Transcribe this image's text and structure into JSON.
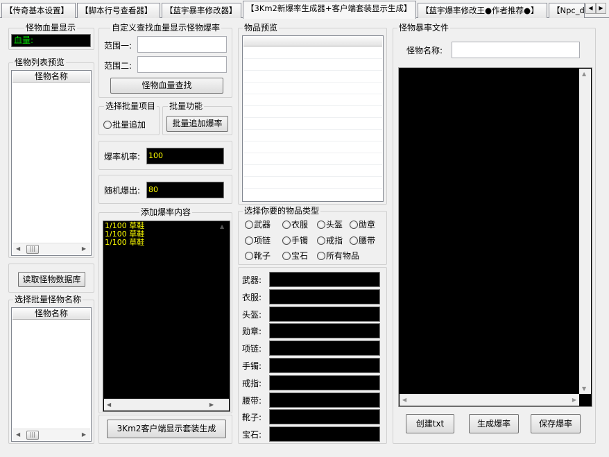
{
  "tabs": [
    {
      "label": "【传奇基本设置】"
    },
    {
      "label": "【脚本行号查看器】"
    },
    {
      "label": "【蓝宇暴率修改器】"
    },
    {
      "label": "【3Km2新爆率生成器+客户端套装显示生成】"
    },
    {
      "label": "【蓝宇爆率修改王●作者推荐●】"
    },
    {
      "label": "【Npc_d"
    }
  ],
  "tab_scroll": {
    "left": "◀",
    "right": "▶"
  },
  "monster_hp": {
    "title": "怪物血量显示",
    "label": "血量:"
  },
  "monster_list": {
    "title": "怪物列表预览",
    "column": "怪物名称"
  },
  "read_db_button": "读取怪物数据库",
  "batch_monster": {
    "title": "选择批量怪物名称",
    "column": "怪物名称"
  },
  "custom_find": {
    "title": "自定义查找血量显示怪物爆率",
    "range1": "范围一:",
    "range2": "范围二:",
    "button": "怪物血量查找"
  },
  "batch_item": {
    "title": "选择批量项目",
    "option": "批量追加"
  },
  "batch_func": {
    "title": "批量功能",
    "button": "批量追加爆率"
  },
  "drop_rate": {
    "label": "爆率机率:",
    "value": "100"
  },
  "random_drop": {
    "label": "随机爆出:",
    "value": "80"
  },
  "add_content": {
    "title": "添加爆率内容",
    "lines": [
      "1/100 草鞋",
      "1/100 草鞋",
      "1/100 草鞋"
    ]
  },
  "client_gen_button": "3Km2客户端显示套装生成",
  "item_preview": {
    "title": "物品预览"
  },
  "item_types": {
    "title": "选择你要的物品类型",
    "options": [
      "武器",
      "衣服",
      "头盔",
      "勋章",
      "项链",
      "手镯",
      "戒指",
      "腰带",
      "靴子",
      "宝石",
      "所有物品"
    ]
  },
  "item_fields": [
    "武器:",
    "衣服:",
    "头盔:",
    "勋章:",
    "项链:",
    "手镯:",
    "戒指:",
    "腰带:",
    "靴子:",
    "宝石:"
  ],
  "monster_file": {
    "title": "怪物暴率文件",
    "name_label": "怪物名称:"
  },
  "bottom_buttons": {
    "create": "创建txt",
    "generate": "生成爆率",
    "save": "保存爆率"
  },
  "scroll_glyphs": {
    "left": "◀",
    "right": "▶",
    "thumb": "|||",
    "up": "▲",
    "down": "▼"
  },
  "colors": {
    "hp_green": "#00e000",
    "rate_yellow": "#ffff00",
    "panel_black": "#000000"
  }
}
